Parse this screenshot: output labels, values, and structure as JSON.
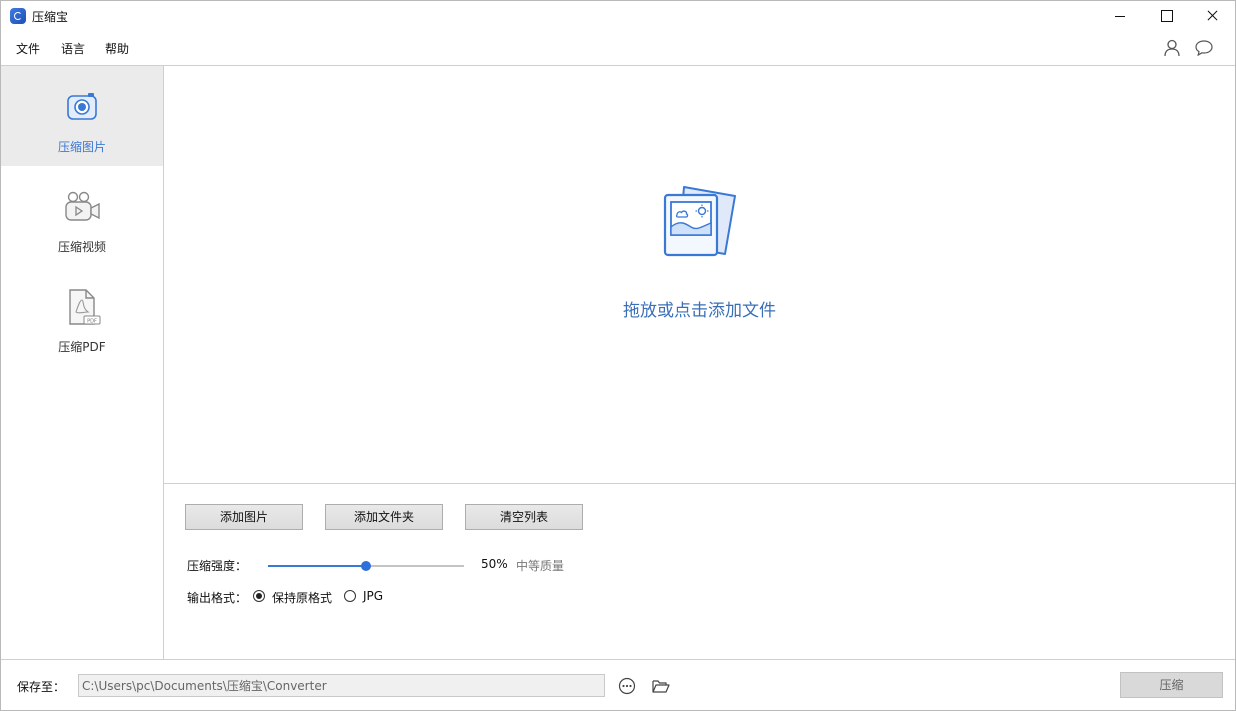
{
  "window": {
    "title": "压缩宝"
  },
  "menu": {
    "file": "文件",
    "language": "语言",
    "help": "帮助"
  },
  "header_icons": [
    "user-icon",
    "chat-icon"
  ],
  "sidebar": {
    "items": [
      {
        "label": "压缩图片",
        "icon": "image-compress-icon",
        "active": true
      },
      {
        "label": "压缩视频",
        "icon": "video-camera-icon",
        "active": false
      },
      {
        "label": "压缩PDF",
        "icon": "pdf-file-icon",
        "active": false
      }
    ]
  },
  "dropzone": {
    "text": "拖放或点击添加文件",
    "icon": "photos-icon"
  },
  "actions": {
    "add_image": "添加图片",
    "add_folder": "添加文件夹",
    "clear_list": "清空列表"
  },
  "strength": {
    "label": "压缩强度：",
    "value_percent": 50,
    "value_text": "50%",
    "quality_text": "中等质量"
  },
  "format": {
    "label": "输出格式：",
    "options": [
      {
        "label": "保持原格式",
        "selected": true
      },
      {
        "label": "JPG",
        "selected": false
      }
    ]
  },
  "footer": {
    "save_label": "保存至：",
    "path": "C:\\Users\\pc\\Documents\\压缩宝\\Converter",
    "compress_button": "压缩"
  },
  "colors": {
    "accent": "#3a78d6",
    "drop_text": "#3a6fb8",
    "active_bg": "#ebebeb"
  }
}
